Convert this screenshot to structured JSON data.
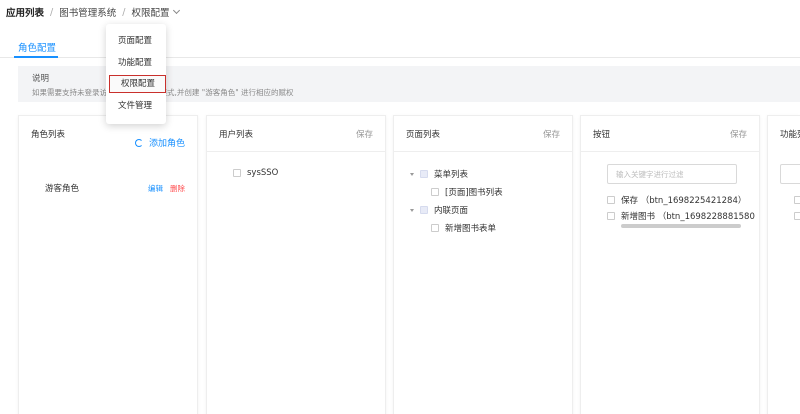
{
  "breadcrumb": {
    "root": "应用列表",
    "app": "图书管理系统",
    "current": "权限配置",
    "separator": "/"
  },
  "tabs": [
    {
      "label": "角色配置",
      "active": true
    }
  ],
  "notice": {
    "title": "说明",
    "text": "如果需要支持未登录访问，请开启游客模式,并创建 \"游客角色\" 进行相应的赋权"
  },
  "dropdown": {
    "items": [
      "页面配置",
      "功能配置",
      "权限配置",
      "文件管理"
    ],
    "active_index": 2
  },
  "roles_panel": {
    "title": "角色列表",
    "add_label": "添加角色",
    "roles": [
      {
        "name": "游客角色",
        "edit": "编辑",
        "delete": "删除"
      }
    ]
  },
  "users_panel": {
    "title": "用户列表",
    "save": "保存",
    "users": [
      "sysSSO"
    ]
  },
  "pages_panel": {
    "title": "页面列表",
    "save": "保存",
    "tree": [
      {
        "label": "菜单列表",
        "children": [
          "[页面]图书列表"
        ]
      },
      {
        "label": "内联页面",
        "children": [
          "新增图书表单"
        ]
      }
    ]
  },
  "buttons_panel": {
    "title": "按钮",
    "save": "保存",
    "filter_placeholder": "输入关键字进行过滤",
    "buttons": [
      "保存 （btn_1698225421284）",
      "新增图书 （btn_1698228881580"
    ]
  },
  "functions_panel": {
    "title": "功能列"
  },
  "colors": {
    "primary": "#1890ff",
    "danger": "#ff4d4f",
    "highlight_border": "#c9302c"
  }
}
